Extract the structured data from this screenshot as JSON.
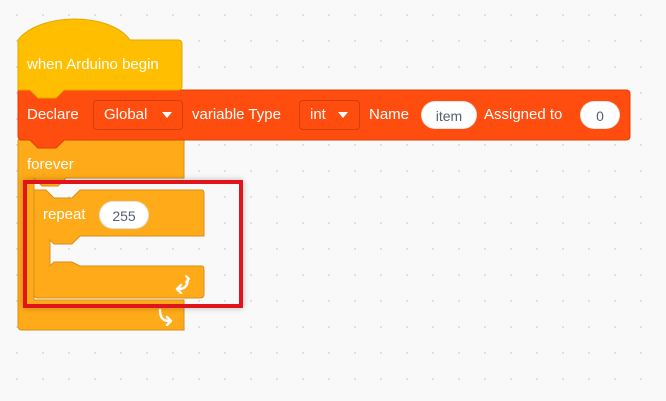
{
  "colors": {
    "event_block": "#ffbf00",
    "declare_block": "#ff4d0f",
    "control_block": "#ffab19",
    "highlight_border": "#e0141b"
  },
  "blocks": {
    "hat": {
      "label": "when Arduino begin"
    },
    "declare": {
      "label": "Declare",
      "scope_value": "Global",
      "type_label": "variable Type",
      "type_value": "int",
      "name_label": "Name",
      "name_value": "item",
      "assigned_label": "Assigned to",
      "assigned_value": "0"
    },
    "forever": {
      "label": "forever",
      "icon": "loop-arrow-icon"
    },
    "repeat": {
      "label": "repeat",
      "count": "255",
      "icon": "loop-arrow-icon"
    }
  }
}
